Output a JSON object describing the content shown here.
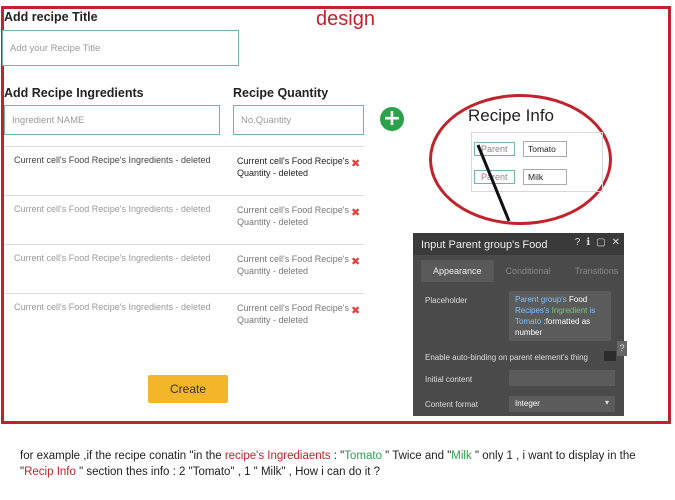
{
  "design": {
    "label": "design",
    "color": "#c0232b"
  },
  "form": {
    "title_label": "Add recipe Title",
    "title_placeholder": "Add your Recipe  Title",
    "ingredients_label": "Add Recipe Ingredients",
    "quantity_label": "Recipe Quantity",
    "ingredient_placeholder": "Ingredient NAME",
    "quantity_placeholder": "No.Quantity",
    "add_icon": "+",
    "create_label": "Create"
  },
  "rows": [
    {
      "ingredient": "Current cell's Food Recipe's Ingredients - deleted",
      "qty_part1": "Current cell's Food Recipe's",
      "qty_part2": "Quantity  - deleted"
    },
    {
      "ingredient": "Current cell's Food Recipe's Ingredients - deleted",
      "qty_part1": "Current cell's Food Recipe's",
      "qty_part2": "Quantity  - deleted"
    },
    {
      "ingredient": "Current cell's Food Recipe's Ingredients - deleted",
      "qty_part1": "Current cell's Food Recipe's",
      "qty_part2": "Quantity  - deleted"
    },
    {
      "ingredient": "Current cell's Food Recipe's Ingredients - deleted",
      "qty_part1": "Current cell's Food Recipe's",
      "qty_part2": "Quantity  - deleted"
    }
  ],
  "recipe_info": {
    "title": "Recipe Info",
    "items": [
      {
        "parent": "Parent",
        "value": "Tomato"
      },
      {
        "parent": "Parent",
        "value": "Milk"
      }
    ]
  },
  "inspector": {
    "title_prefix": "Input Parent group's",
    "title_name": "Food",
    "tabs": [
      "Appearance",
      "Conditional",
      "Transitions"
    ],
    "placeholder_label": "Placeholder",
    "placeholder_value_line1": "Parent group's",
    "placeholder_value_line1b": "Food",
    "placeholder_value_line2": "Recipes's",
    "placeholder_value_line2b": "Ingredient",
    "placeholder_value_line2c": "is",
    "placeholder_value_line3a": "Tomato",
    "placeholder_value_line3b": ":formatted as",
    "placeholder_value_line4": "number",
    "autobind_label": "Enable auto-binding on parent element's thing",
    "initial_content_label": "Initial content",
    "content_format_label": "Content format",
    "content_format_value": "Integer",
    "help_icon": "?"
  },
  "question": {
    "p1": "for example  ,if the recipe conatin \"in the ",
    "p2": "recipe's Ingrediaents",
    "p3": " : \"",
    "p4": "Tomato",
    "p5": " \" Twice and \"",
    "p6": "Milk",
    "p7": " \"  only 1  , i want to display in the \"",
    "p8": "Recip Info",
    "p9": " \" section thes info : 2 \"Tomato\" , 1 \" Milk\"  , How i can do it  ?"
  }
}
